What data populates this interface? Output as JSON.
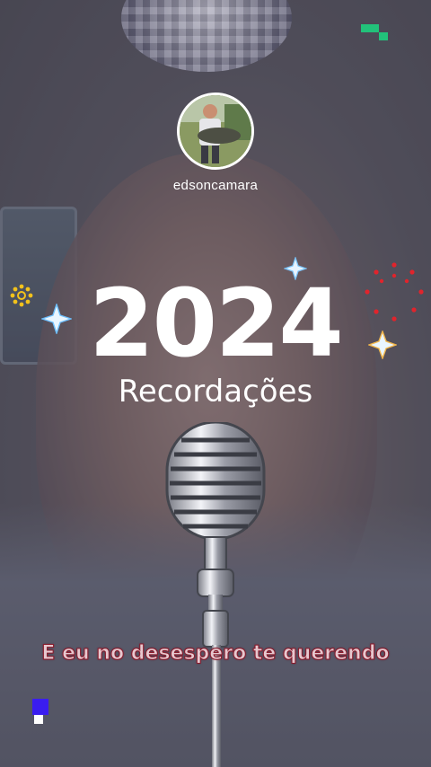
{
  "profile": {
    "username": "edsoncamara"
  },
  "recap": {
    "year": "2024",
    "subtitle": "Recordações"
  },
  "lyrics": {
    "current_line": "E eu no desespero te querendo"
  },
  "colors": {
    "text": "#ffffff",
    "lyric_fill": "#e7c8cf",
    "lyric_stroke": "#8a1b2c",
    "pixel_green": "#22c27a",
    "pixel_blue": "#3a1df0",
    "firework_red": "#e0242c",
    "sunburst_yellow": "#f2c21b"
  },
  "icons": [
    "disco-ball-icon",
    "microphone-icon",
    "sparkle-icon",
    "firework-icon",
    "sunburst-icon",
    "pixel-decoration-icon"
  ]
}
